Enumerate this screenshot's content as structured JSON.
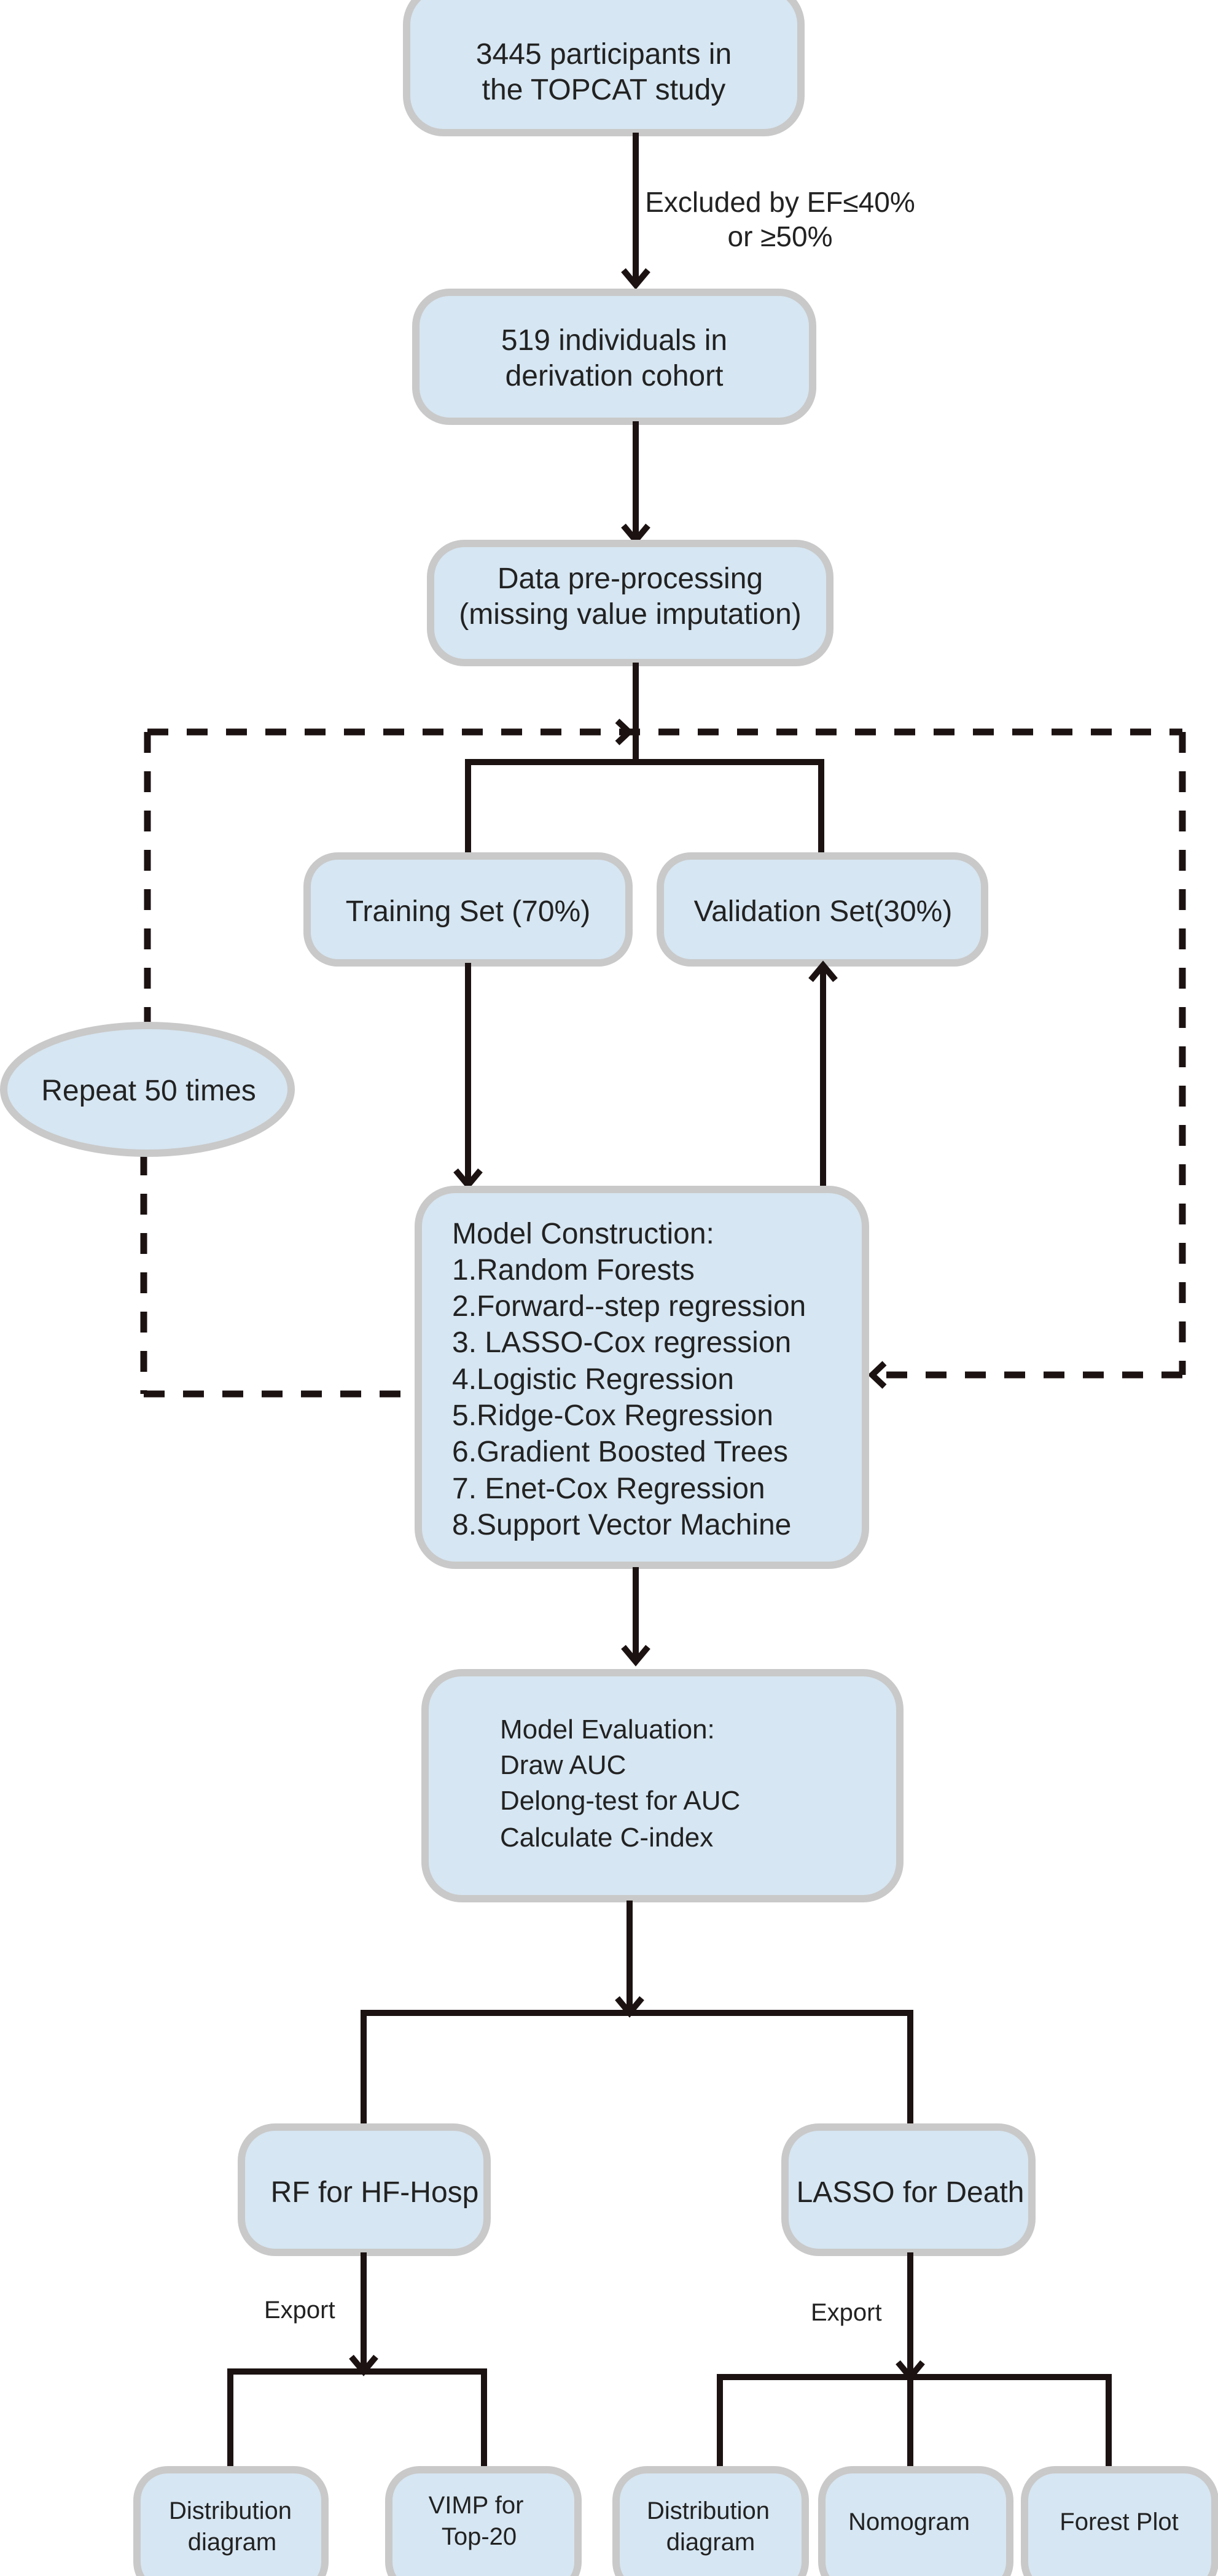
{
  "colors": {
    "box_fill": "#d6e6f2",
    "box_border": "#c9c9c9",
    "line": "#1c1212"
  },
  "participants": {
    "lines": [
      "3445 participants in",
      "the TOPCAT study"
    ]
  },
  "exclusion": {
    "lines": [
      "Excluded by EF≤40%",
      "or ≥50%"
    ]
  },
  "derivation": {
    "lines": [
      "519 individuals in",
      "derivation cohort"
    ]
  },
  "preprocessing": {
    "lines": [
      "Data pre-processing",
      "(missing value imputation)"
    ]
  },
  "training": {
    "label": "Training Set (70%)"
  },
  "validation": {
    "label": "Validation Set(30%)"
  },
  "repeat": {
    "label": "Repeat 50 times"
  },
  "model_construction": {
    "title": "Model Construction:",
    "items": [
      "1.Random Forests",
      "2.Forward--step regression",
      "3. LASSO-Cox regression",
      "4.Logistic Regression",
      "5.Ridge-Cox Regression",
      "6.Gradient Boosted Trees",
      "7. Enet-Cox Regression",
      "8.Support Vector Machine"
    ]
  },
  "model_evaluation": {
    "title": "Model Evaluation:",
    "items": [
      "Draw AUC",
      "Delong-test for AUC",
      "Calculate C-index"
    ]
  },
  "rf_branch": {
    "label": "RF for HF-Hosp",
    "export": "Export",
    "outputs": [
      {
        "lines": [
          "Distribution",
          "diagram"
        ]
      },
      {
        "lines": [
          "VIMP for",
          "Top-20"
        ]
      }
    ]
  },
  "lasso_branch": {
    "label": "LASSO for Death",
    "export": "Export",
    "outputs": [
      {
        "lines": [
          "Distribution",
          "diagram"
        ]
      },
      {
        "lines": [
          "Nomogram"
        ]
      },
      {
        "lines": [
          "Forest Plot"
        ]
      }
    ]
  }
}
